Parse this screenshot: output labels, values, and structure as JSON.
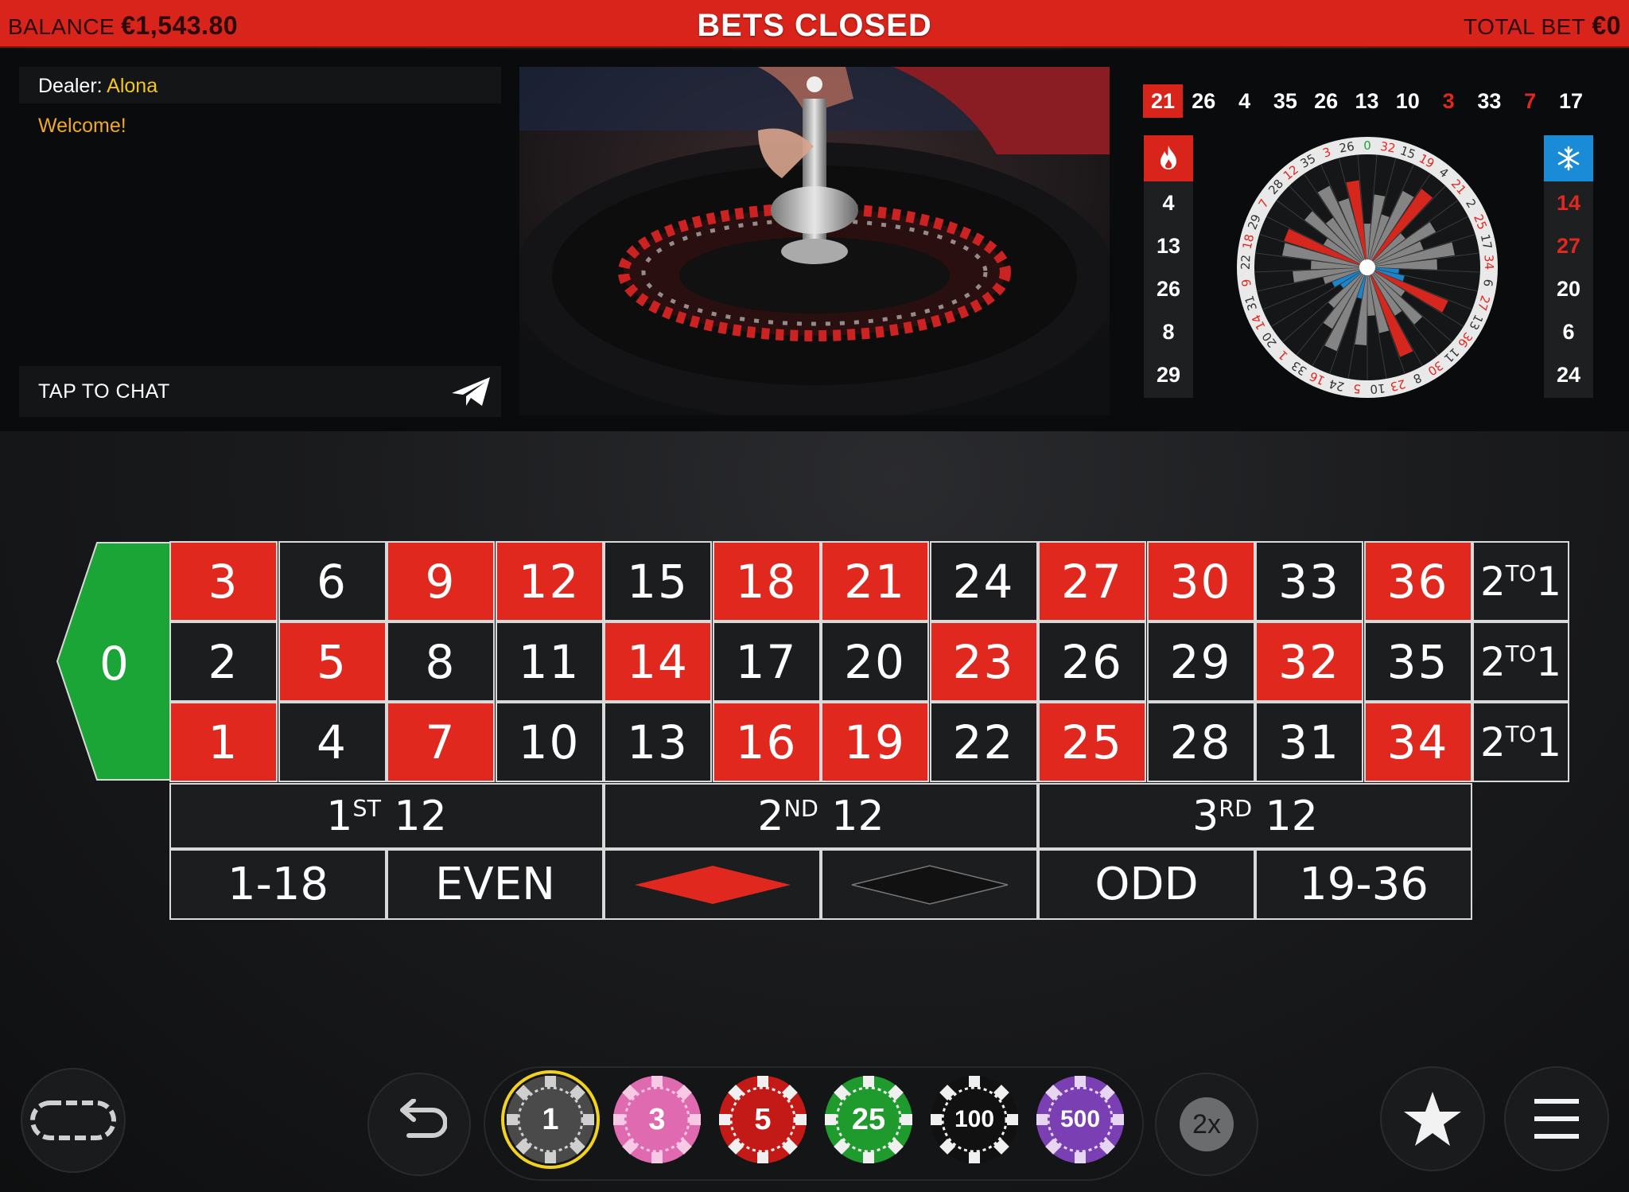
{
  "topbar": {
    "balance_label": "BALANCE",
    "balance_value": "€1,543.80",
    "status": "BETS CLOSED",
    "total_bet_label": "TOTAL BET",
    "total_bet_value": "€0"
  },
  "chat": {
    "dealer_label": "Dealer:",
    "dealer_name": "Alona",
    "welcome_message": "Welcome!",
    "input_placeholder": "TAP TO CHAT"
  },
  "history": [
    {
      "n": "21",
      "color": "red",
      "latest": true
    },
    {
      "n": "26",
      "color": "black"
    },
    {
      "n": "4",
      "color": "black"
    },
    {
      "n": "35",
      "color": "black"
    },
    {
      "n": "26",
      "color": "black"
    },
    {
      "n": "13",
      "color": "black"
    },
    {
      "n": "10",
      "color": "black"
    },
    {
      "n": "3",
      "color": "red"
    },
    {
      "n": "33",
      "color": "black"
    },
    {
      "n": "7",
      "color": "red"
    },
    {
      "n": "17",
      "color": "black"
    }
  ],
  "hot_numbers": [
    {
      "n": "4",
      "color": "black"
    },
    {
      "n": "13",
      "color": "black"
    },
    {
      "n": "26",
      "color": "black"
    },
    {
      "n": "8",
      "color": "black"
    },
    {
      "n": "29",
      "color": "black"
    }
  ],
  "cold_numbers": [
    {
      "n": "14",
      "color": "red"
    },
    {
      "n": "27",
      "color": "red"
    },
    {
      "n": "20",
      "color": "black"
    },
    {
      "n": "6",
      "color": "black"
    },
    {
      "n": "24",
      "color": "black"
    }
  ],
  "wheel_sequence": [
    "0",
    "32",
    "15",
    "19",
    "4",
    "21",
    "2",
    "25",
    "17",
    "34",
    "6",
    "27",
    "13",
    "36",
    "11",
    "30",
    "8",
    "23",
    "10",
    "5",
    "24",
    "16",
    "33",
    "1",
    "20",
    "14",
    "31",
    "9",
    "22",
    "18",
    "29",
    "7",
    "28",
    "12",
    "35",
    "3",
    "26"
  ],
  "table": {
    "zero": "0",
    "top_row": [
      {
        "n": "3",
        "color": "red"
      },
      {
        "n": "6",
        "color": "black"
      },
      {
        "n": "9",
        "color": "red"
      },
      {
        "n": "12",
        "color": "red"
      },
      {
        "n": "15",
        "color": "black"
      },
      {
        "n": "18",
        "color": "red"
      },
      {
        "n": "21",
        "color": "red"
      },
      {
        "n": "24",
        "color": "black"
      },
      {
        "n": "27",
        "color": "red"
      },
      {
        "n": "30",
        "color": "red"
      },
      {
        "n": "33",
        "color": "black"
      },
      {
        "n": "36",
        "color": "red"
      }
    ],
    "middle_row": [
      {
        "n": "2",
        "color": "black"
      },
      {
        "n": "5",
        "color": "red"
      },
      {
        "n": "8",
        "color": "black"
      },
      {
        "n": "11",
        "color": "black"
      },
      {
        "n": "14",
        "color": "red"
      },
      {
        "n": "17",
        "color": "black"
      },
      {
        "n": "20",
        "color": "black"
      },
      {
        "n": "23",
        "color": "red"
      },
      {
        "n": "26",
        "color": "black"
      },
      {
        "n": "29",
        "color": "black"
      },
      {
        "n": "32",
        "color": "red"
      },
      {
        "n": "35",
        "color": "black"
      }
    ],
    "bottom_row": [
      {
        "n": "1",
        "color": "red"
      },
      {
        "n": "4",
        "color": "black"
      },
      {
        "n": "7",
        "color": "red"
      },
      {
        "n": "10",
        "color": "black"
      },
      {
        "n": "13",
        "color": "black"
      },
      {
        "n": "16",
        "color": "red"
      },
      {
        "n": "19",
        "color": "red"
      },
      {
        "n": "22",
        "color": "black"
      },
      {
        "n": "25",
        "color": "red"
      },
      {
        "n": "28",
        "color": "black"
      },
      {
        "n": "31",
        "color": "black"
      },
      {
        "n": "34",
        "color": "red"
      }
    ],
    "column_bet": {
      "pre": "2",
      "sup": "TO",
      "post": "1"
    },
    "dozens": [
      {
        "pre": "1",
        "sup": "ST",
        "post": " 12"
      },
      {
        "pre": "2",
        "sup": "ND",
        "post": " 12"
      },
      {
        "pre": "3",
        "sup": "RD",
        "post": " 12"
      }
    ],
    "outside": {
      "low": "1-18",
      "even": "EVEN",
      "odd": "ODD",
      "high": "19-36"
    }
  },
  "chips": [
    {
      "value": "1",
      "color": "#4a4a4a",
      "stripe": "#cfcfcf",
      "selected": true
    },
    {
      "value": "3",
      "color": "#e06ab0",
      "stripe": "#f7c9e4"
    },
    {
      "value": "5",
      "color": "#c41a17",
      "stripe": "#f0f0f0"
    },
    {
      "value": "25",
      "color": "#1f9a2c",
      "stripe": "#f0f0f0"
    },
    {
      "value": "100",
      "color": "#111111",
      "stripe": "#f0f0f0"
    },
    {
      "value": "500",
      "color": "#7a3fb3",
      "stripe": "#e6d6f3"
    }
  ],
  "controls": {
    "double_label": "2x"
  },
  "colors": {
    "red": "#e0281f",
    "black": "#1c1d1f",
    "green": "#1aa536",
    "topbar": "#d8241b",
    "hot": "#d8241b",
    "cold": "#1a8bd6",
    "selected_ring": "#f3d21f"
  }
}
